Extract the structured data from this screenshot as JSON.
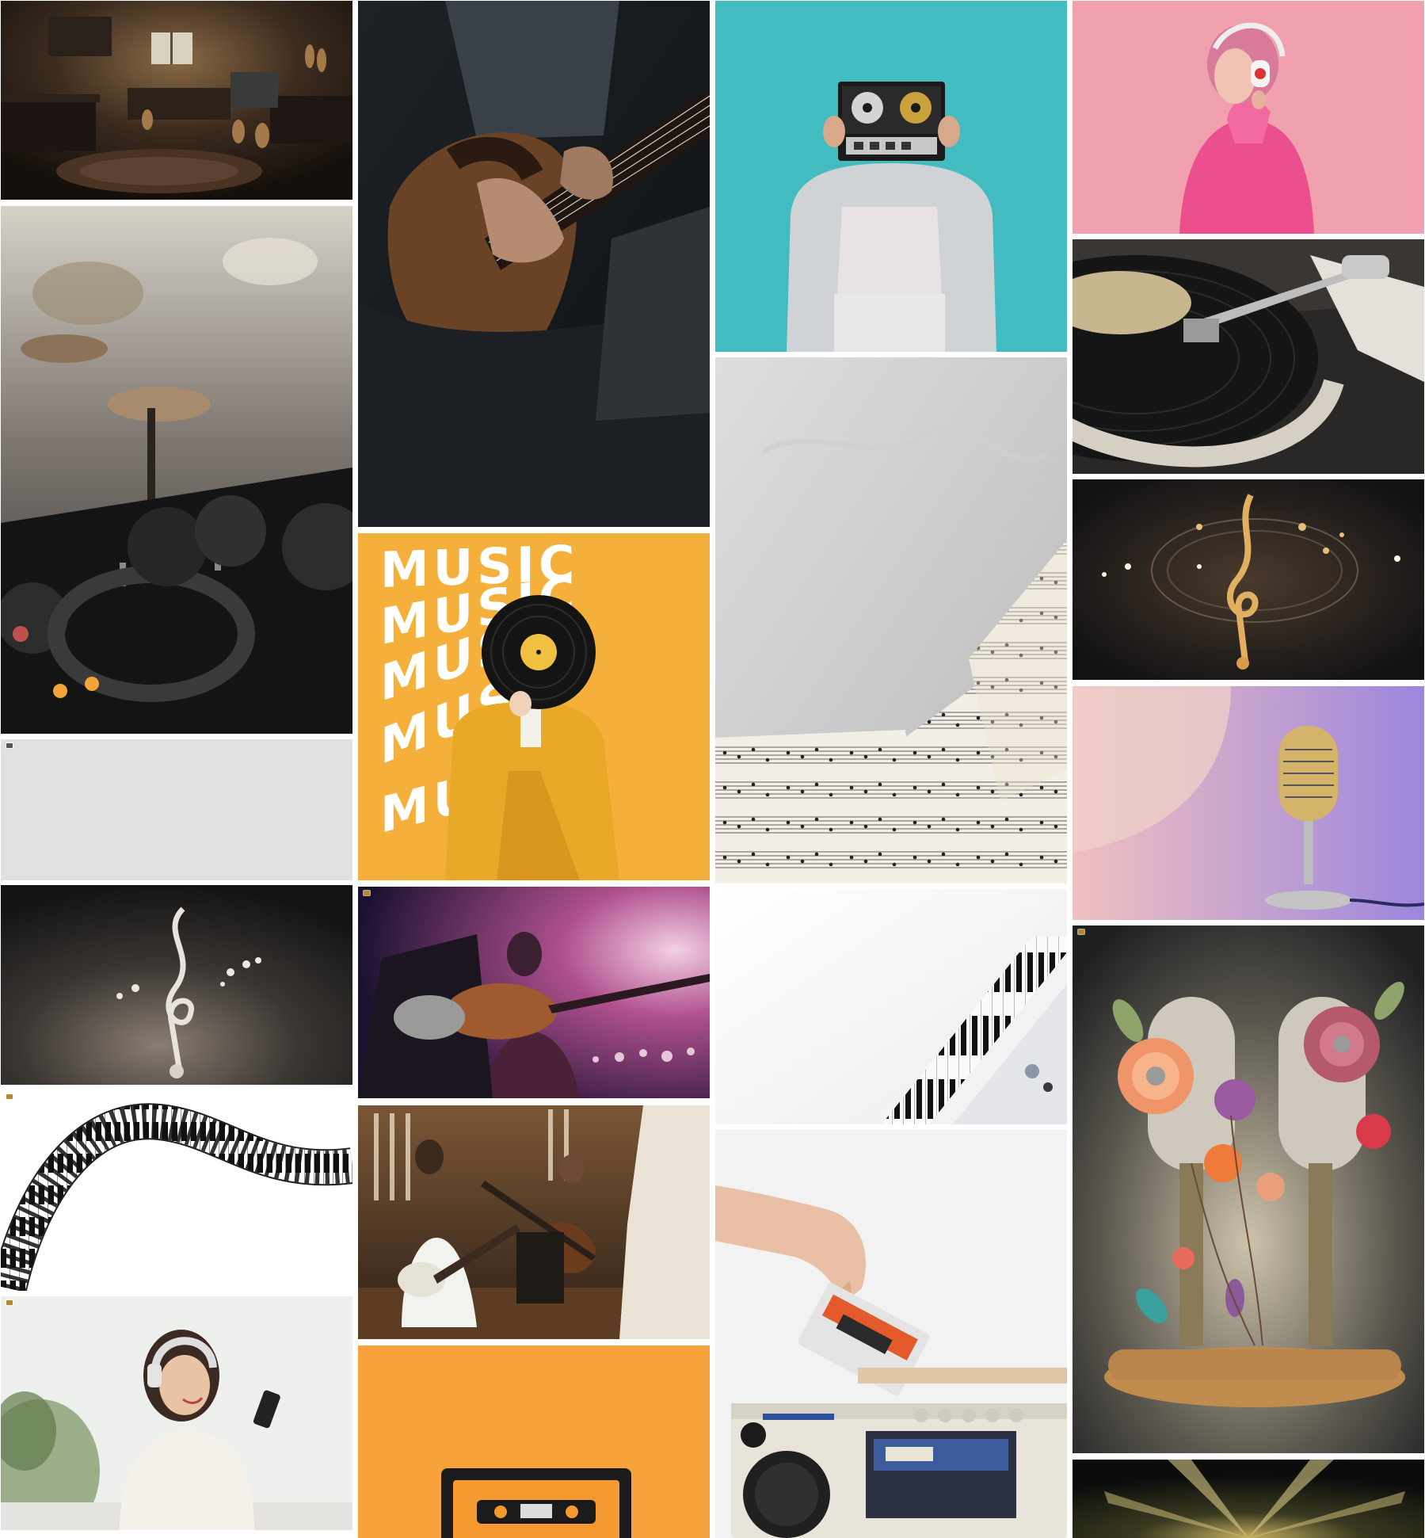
{
  "page": {
    "background": "#ffffff"
  },
  "gallery": {
    "tiles": [
      {
        "name": "music-studio-room-photo",
        "subject": "vintage music studio room with pianos and guitars"
      },
      {
        "name": "guitarist-playing-photo",
        "subject": "close-up of hands playing an acoustic guitar"
      },
      {
        "name": "reel-to-reel-person-photo",
        "subject": "person holding a reel-to-reel tape recorder over face on teal background"
      },
      {
        "name": "headphones-woman-photo",
        "subject": "woman with pink hair wearing headphones on pink background"
      },
      {
        "name": "dj-controller-headphones-photo",
        "subject": "headphones resting on a DJ controller"
      },
      {
        "name": "record-player-photo",
        "subject": "vinyl record on a turntable"
      },
      {
        "name": "sheet-music-texture-photo",
        "subject": "sheet music pages on gray stone texture"
      },
      {
        "name": "golden-treble-clef-photo",
        "subject": "golden treble clef with swirling notes"
      },
      {
        "name": "music-poster-photo",
        "subject": "person in yellow suit holding a vinyl record",
        "poster_lines": [
          "MUSIC",
          "MUSIC",
          "MUSIC",
          "MUSIC",
          "MUSIC"
        ]
      },
      {
        "name": "vintage-microphone-photo",
        "subject": "vintage microphone on lilac background"
      },
      {
        "name": "loading-placeholder",
        "subject": "image placeholder"
      },
      {
        "name": "silver-treble-clef-photo",
        "subject": "silver treble clef with notes on dark background"
      },
      {
        "name": "concert-guitar-singer-photo",
        "subject": "guitarist and singer performing on stage"
      },
      {
        "name": "white-keyboard-photo",
        "subject": "white synthesizer keyboard"
      },
      {
        "name": "flower-microphones-photo",
        "subject": "two microphones decorated with flowers"
      },
      {
        "name": "wavy-piano-keys-photo",
        "subject": "curved piano keyboard on white background"
      },
      {
        "name": "band-rehearsal-photo",
        "subject": "band playing guitars in a studio"
      },
      {
        "name": "cassette-boombox-photo",
        "subject": "hand inserting a cassette into a boombox"
      },
      {
        "name": "woman-headphones-phone-photo",
        "subject": "smiling woman with headphones holding a phone"
      },
      {
        "name": "orange-cassette-photo",
        "subject": "cassette tape on orange background"
      },
      {
        "name": "stage-lights-photo",
        "subject": "stage lights in darkness"
      }
    ]
  }
}
